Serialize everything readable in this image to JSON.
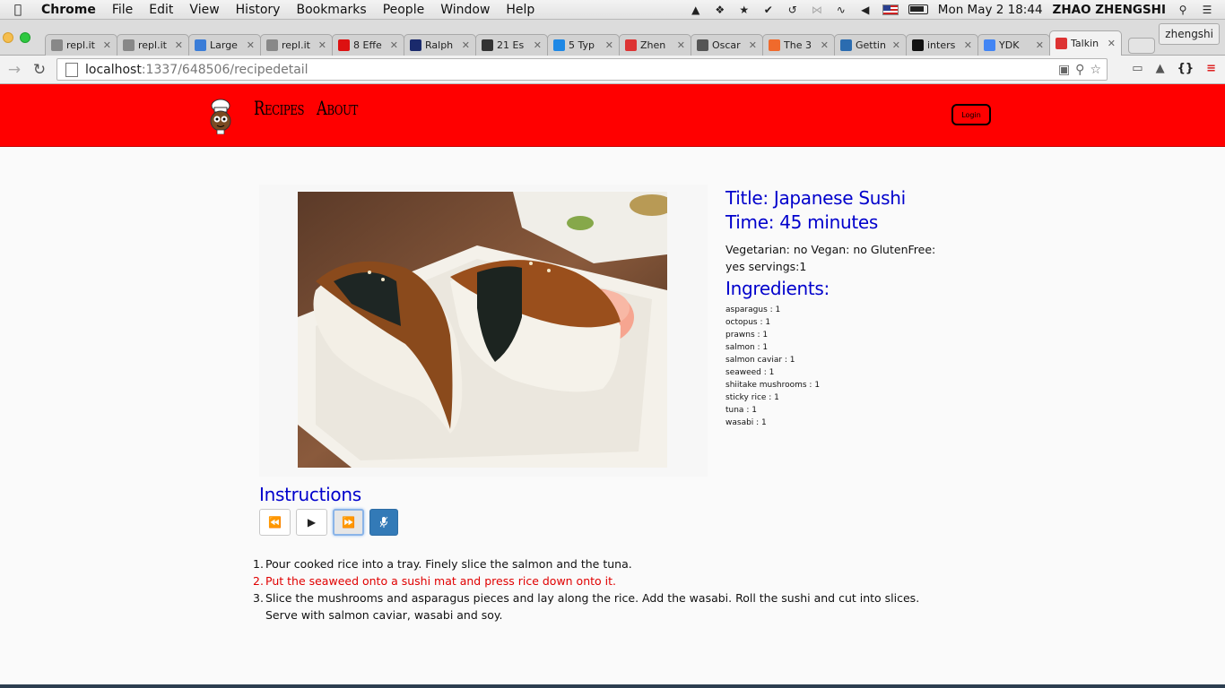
{
  "menubar": {
    "app_name": "Chrome",
    "items": [
      "File",
      "Edit",
      "View",
      "History",
      "Bookmarks",
      "People",
      "Window",
      "Help"
    ],
    "clock": "Mon May 2  18:44",
    "user": "ZHAO ZHENGSHI"
  },
  "tabs": [
    {
      "label": "repl.it",
      "icon": "repl-icon",
      "color": "#888888"
    },
    {
      "label": "repl.it",
      "icon": "repl-icon",
      "color": "#888888"
    },
    {
      "label": "Large",
      "icon": "infinity-icon",
      "color": "#3b7dd8"
    },
    {
      "label": "repl.it",
      "icon": "repl-icon",
      "color": "#888888"
    },
    {
      "label": "8 Effe",
      "icon": "cxl-icon",
      "color": "#d11"
    },
    {
      "label": "Ralph",
      "icon": "polo-icon",
      "color": "#1a2a6c"
    },
    {
      "label": "21 Es",
      "icon": "monitor-icon",
      "color": "#333"
    },
    {
      "label": "5 Typ",
      "icon": "bolt-icon",
      "color": "#1e88e5"
    },
    {
      "label": "Zhen",
      "icon": "diamond-icon",
      "color": "#d33"
    },
    {
      "label": "Oscar",
      "icon": "ring-icon",
      "color": "#555"
    },
    {
      "label": "The 3",
      "icon": "square-icon",
      "color": "#f06a2c"
    },
    {
      "label": "Gettin",
      "icon": "book-icon",
      "color": "#2b6cb0"
    },
    {
      "label": "inters",
      "icon": "github-icon",
      "color": "#111"
    },
    {
      "label": "YDK",
      "icon": "google-icon",
      "color": "#4285f4"
    },
    {
      "label": "Talkin",
      "icon": "diamond-icon",
      "color": "#d33",
      "active": true
    }
  ],
  "profile_name": "zhengshi",
  "address": {
    "host": "localhost",
    "path": ":1337/648506/recipedetail"
  },
  "site": {
    "nav_recipes": "Recipes",
    "nav_about": "About",
    "login": "Login",
    "brand_color": "#ff0000"
  },
  "recipe": {
    "title_line": "Title: Japanese Sushi",
    "time_line": "Time: 45 minutes",
    "flags_line": "Vegetarian: no Vegan: no GlutenFree: yes servings:1",
    "ingredients_heading": "Ingredients:",
    "ingredients": [
      "asparagus : 1",
      "octopus : 1",
      "prawns : 1",
      "salmon : 1",
      "salmon caviar : 1",
      "seaweed : 1",
      "shiitake mushrooms : 1",
      "sticky rice : 1",
      "tuna : 1",
      "wasabi : 1"
    ],
    "instructions_heading": "Instructions",
    "steps": [
      "Pour cooked rice into a tray. Finely slice the salmon and the tuna.",
      "Put the seaweed onto a sushi mat and press rice down onto it.",
      "Slice the mushrooms and asparagus pieces and lay along the rice. Add the wasabi. Roll the sushi and cut into slices. Serve with salmon caviar, wasabi and soy."
    ],
    "current_step": 2,
    "heading_color": "#0000cc",
    "highlight_color": "#e00000"
  }
}
